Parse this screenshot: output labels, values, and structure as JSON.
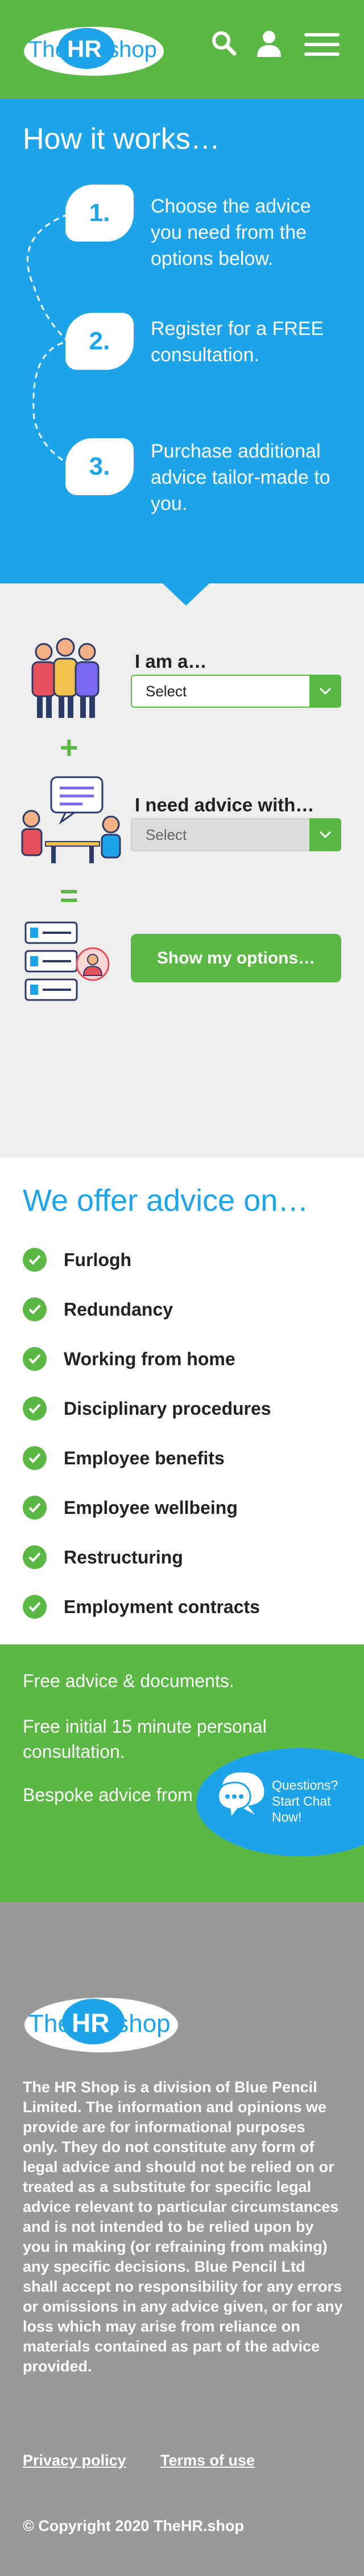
{
  "header": {
    "logo": {
      "part1": "The",
      "part2": "HR",
      "part3": ".shop"
    },
    "icons": [
      "search-icon",
      "user-icon",
      "menu-icon"
    ]
  },
  "how": {
    "title": "How it works…",
    "steps": [
      {
        "number": "1.",
        "text": "Choose the advice you need from the options below."
      },
      {
        "number": "2.",
        "text": "Register for a FREE consultation."
      },
      {
        "number": "3.",
        "text": "Purchase additional advice tailor-made to you."
      }
    ]
  },
  "selector": {
    "iam_label": "I am a…",
    "iam_value": "Select",
    "need_label": "I need advice with…",
    "need_value": "Select",
    "plus": "+",
    "equals": "=",
    "button": "Show my options…"
  },
  "advice": {
    "title": "We offer advice on…",
    "items": [
      "Furlogh",
      "Redundancy",
      "Working from home",
      "Disciplinary procedures",
      "Employee benefits",
      "Employee wellbeing",
      "Restructuring",
      "Employment contracts"
    ]
  },
  "info": {
    "line1": "Free advice & documents.",
    "line2": "Free initial 15 minute personal consultation.",
    "line3": "Bespoke advice from £99 inc VAT.",
    "chat": "Questions? Start Chat Now!"
  },
  "footer": {
    "logo": {
      "part1": "The",
      "part2": "HR",
      "part3": ".shop"
    },
    "disclaimer": "The HR Shop is a division of Blue Pencil Limited. The information and opinions we provide are for informational purposes only. They do not constitute any form of legal advice and should not be relied on or treated as a substitute for specific legal advice relevant to particular circumstances and is not intended to be relied upon by you in making (or refraining from making) any specific decisions. Blue Pencil Ltd shall accept no responsibility for any errors or omissions in any advice given, or for any loss which may arise from reliance on materials contained as part of the advice provided.",
    "privacy": "Privacy policy",
    "terms": "Terms of use",
    "copyright": "© Copyright 2020 TheHR.shop"
  },
  "colors": {
    "green": "#5cb845",
    "blue": "#1ea4e9",
    "grey": "#999999",
    "light": "#eeeeee"
  }
}
